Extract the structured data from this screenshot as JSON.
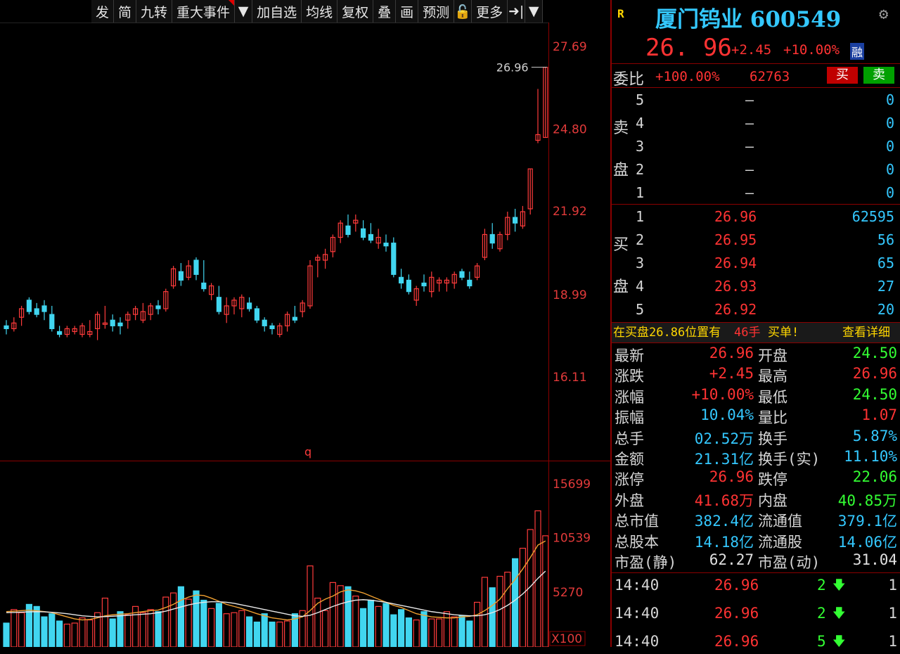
{
  "toolbar": {
    "items": [
      {
        "label": "发"
      },
      {
        "label": "简"
      },
      {
        "label": "九转"
      },
      {
        "label": "重大事件",
        "flag": true
      },
      {
        "label": "▼",
        "square": true
      },
      {
        "label": "加自选"
      },
      {
        "label": "均线"
      },
      {
        "label": "复权"
      },
      {
        "label": "叠"
      },
      {
        "label": "画"
      },
      {
        "label": "预测"
      },
      {
        "label": "🔓",
        "square": true
      },
      {
        "label": "更多"
      },
      {
        "label": "➜|",
        "square": true
      },
      {
        "label": "▼",
        "square": true
      }
    ]
  },
  "chart_data": {
    "type": "candlestick",
    "price_axis_ticks": [
      "27.69",
      "24.80",
      "21.92",
      "18.99",
      "16.11"
    ],
    "price_axis_values": [
      27.69,
      24.8,
      21.92,
      18.99,
      16.11
    ],
    "volume_axis_ticks": [
      "15699",
      "10539",
      "5270"
    ],
    "volume_unit": "X100",
    "last_price_label": "26.96",
    "marker_label": "q",
    "candles": [
      [
        17.9,
        18.1,
        17.6,
        17.8
      ],
      [
        17.8,
        18.2,
        17.7,
        18.0
      ],
      [
        18.2,
        18.6,
        17.9,
        18.5
      ],
      [
        18.8,
        18.9,
        18.3,
        18.4
      ],
      [
        18.5,
        18.7,
        18.2,
        18.3
      ],
      [
        18.6,
        18.8,
        18.1,
        18.4
      ],
      [
        18.3,
        18.6,
        17.7,
        17.8
      ],
      [
        17.7,
        17.9,
        17.5,
        17.6
      ],
      [
        17.6,
        17.9,
        17.5,
        17.8
      ],
      [
        17.7,
        17.9,
        17.6,
        17.8
      ],
      [
        17.6,
        18.0,
        17.5,
        17.9
      ],
      [
        17.6,
        18.1,
        17.5,
        17.7
      ],
      [
        17.8,
        18.4,
        17.4,
        18.3
      ],
      [
        18.0,
        18.6,
        17.8,
        18.0
      ],
      [
        18.1,
        18.3,
        17.7,
        17.9
      ],
      [
        18.0,
        18.2,
        17.6,
        17.9
      ],
      [
        18.1,
        18.4,
        17.8,
        18.3
      ],
      [
        18.3,
        18.6,
        18.1,
        18.5
      ],
      [
        18.1,
        18.7,
        18.0,
        18.4
      ],
      [
        18.3,
        18.7,
        18.1,
        18.6
      ],
      [
        18.6,
        18.8,
        18.3,
        18.5
      ],
      [
        18.5,
        19.2,
        18.4,
        19.1
      ],
      [
        19.3,
        20.0,
        19.2,
        19.9
      ],
      [
        19.8,
        20.1,
        19.3,
        19.5
      ],
      [
        19.6,
        20.2,
        19.5,
        20.0
      ],
      [
        20.2,
        20.3,
        19.5,
        19.7
      ],
      [
        19.4,
        20.2,
        19.1,
        19.2
      ],
      [
        19.0,
        19.4,
        18.8,
        19.3
      ],
      [
        18.9,
        19.3,
        18.3,
        18.4
      ],
      [
        18.3,
        18.9,
        18.0,
        18.6
      ],
      [
        18.6,
        18.9,
        18.3,
        18.8
      ],
      [
        18.5,
        19.0,
        18.2,
        18.9
      ],
      [
        18.7,
        18.9,
        18.4,
        18.5
      ],
      [
        18.5,
        18.6,
        18.0,
        18.1
      ],
      [
        18.1,
        18.2,
        17.7,
        17.9
      ],
      [
        17.9,
        18.0,
        17.6,
        17.8
      ],
      [
        17.6,
        18.0,
        17.5,
        17.9
      ],
      [
        17.9,
        18.4,
        17.7,
        18.3
      ],
      [
        18.2,
        18.6,
        18.0,
        18.1
      ],
      [
        18.4,
        18.8,
        18.2,
        18.7
      ],
      [
        18.6,
        20.2,
        18.5,
        20.0
      ],
      [
        20.2,
        20.4,
        19.6,
        20.3
      ],
      [
        20.2,
        20.6,
        19.9,
        20.4
      ],
      [
        20.5,
        21.1,
        20.3,
        21.0
      ],
      [
        21.0,
        21.6,
        20.8,
        21.5
      ],
      [
        21.4,
        21.8,
        21.0,
        21.1
      ],
      [
        21.5,
        21.8,
        21.2,
        21.6
      ],
      [
        21.3,
        21.6,
        20.9,
        21.0
      ],
      [
        21.1,
        21.5,
        20.8,
        20.9
      ],
      [
        20.8,
        21.3,
        20.6,
        21.0
      ],
      [
        20.8,
        21.1,
        20.5,
        20.7
      ],
      [
        20.8,
        21.0,
        19.6,
        19.7
      ],
      [
        19.6,
        19.9,
        19.2,
        19.4
      ],
      [
        19.5,
        19.7,
        19.0,
        19.1
      ],
      [
        18.8,
        19.3,
        18.6,
        19.2
      ],
      [
        19.4,
        19.7,
        19.1,
        19.3
      ],
      [
        19.1,
        19.8,
        18.9,
        19.6
      ],
      [
        19.4,
        19.6,
        19.1,
        19.5
      ],
      [
        19.4,
        19.6,
        19.1,
        19.5
      ],
      [
        19.4,
        19.8,
        19.2,
        19.7
      ],
      [
        19.8,
        19.9,
        19.5,
        19.6
      ],
      [
        19.5,
        19.8,
        19.2,
        19.3
      ],
      [
        19.6,
        20.1,
        19.5,
        20.0
      ],
      [
        20.3,
        21.3,
        20.2,
        21.1
      ],
      [
        21.1,
        21.5,
        20.6,
        20.8
      ],
      [
        20.6,
        21.2,
        20.5,
        21.1
      ],
      [
        21.1,
        21.9,
        20.9,
        21.7
      ],
      [
        21.7,
        22.0,
        21.2,
        21.5
      ],
      [
        21.4,
        22.1,
        21.3,
        21.9
      ],
      [
        22.0,
        23.4,
        21.8,
        23.4
      ],
      [
        24.4,
        26.2,
        24.3,
        24.6
      ],
      [
        24.5,
        26.96,
        24.5,
        26.96
      ]
    ],
    "volumes": [
      2300,
      3600,
      3300,
      4100,
      3900,
      2900,
      3200,
      2500,
      2200,
      2300,
      2800,
      2600,
      3300,
      4700,
      2700,
      3400,
      3100,
      3900,
      3300,
      3600,
      3400,
      4800,
      5200,
      5800,
      4600,
      5400,
      4500,
      3700,
      4200,
      3200,
      3300,
      3500,
      2900,
      2400,
      3200,
      2400,
      2400,
      2500,
      3200,
      3500,
      7800,
      4700,
      3500,
      6200,
      5900,
      5800,
      4900,
      3700,
      4500,
      3900,
      4200,
      3100,
      3600,
      2800,
      2600,
      3400,
      2700,
      2700,
      3400,
      2900,
      3000,
      2500,
      4300,
      6700,
      5700,
      6800,
      7200,
      8500,
      9500,
      11300,
      13100,
      10700
    ],
    "ma5": [
      3400,
      3450,
      3500,
      3550,
      3480,
      3400,
      3300,
      3100,
      2900,
      2700,
      2600,
      2650,
      2800,
      3000,
      3100,
      3150,
      3200,
      3300,
      3400,
      3500,
      3550,
      3800,
      4100,
      4500,
      4800,
      5000,
      4950,
      4700,
      4400,
      4100,
      3900,
      3700,
      3450,
      3200,
      3000,
      2800,
      2700,
      2600,
      2700,
      2900,
      3500,
      4200,
      4600,
      4900,
      5300,
      5500,
      5400,
      5200,
      4900,
      4600,
      4300,
      4000,
      3800,
      3500,
      3200,
      3050,
      2900,
      2850,
      2800,
      2800,
      2900,
      2950,
      3100,
      3500,
      4000,
      4600,
      5600,
      6500,
      7500,
      8600,
      9800,
      10200
    ],
    "ma10": [
      3300,
      3320,
      3350,
      3380,
      3400,
      3380,
      3340,
      3280,
      3200,
      3100,
      3000,
      2950,
      2900,
      2920,
      2960,
      3000,
      3050,
      3100,
      3150,
      3200,
      3300,
      3450,
      3650,
      3850,
      4050,
      4200,
      4300,
      4350,
      4350,
      4300,
      4200,
      4050,
      3900,
      3750,
      3600,
      3450,
      3300,
      3150,
      3000,
      2950,
      3050,
      3300,
      3600,
      3900,
      4150,
      4350,
      4500,
      4550,
      4500,
      4400,
      4300,
      4150,
      4000,
      3850,
      3700,
      3550,
      3400,
      3300,
      3200,
      3100,
      3050,
      3000,
      3000,
      3100,
      3300,
      3600,
      4000,
      4500,
      5100,
      5800,
      6600,
      7300
    ]
  },
  "panel": {
    "r_badge": "R",
    "title": "厦门钨业 600549",
    "price": "26. 96",
    "change": "+2.45",
    "pct": "+10.00%",
    "fin_badge": "融",
    "weibi_label": "委比",
    "weibi_pct": "+100.00%",
    "weibi_num": "62763",
    "buy_btn": "买",
    "sell_btn": "卖",
    "sell_label_1": "卖",
    "sell_label_2": "盘",
    "buy_label_1": "买",
    "buy_label_2": "盘",
    "sell_levels": [
      {
        "n": "5",
        "price": "—",
        "vol": "0"
      },
      {
        "n": "4",
        "price": "—",
        "vol": "0"
      },
      {
        "n": "3",
        "price": "—",
        "vol": "0"
      },
      {
        "n": "2",
        "price": "—",
        "vol": "0"
      },
      {
        "n": "1",
        "price": "—",
        "vol": "0"
      }
    ],
    "buy_levels": [
      {
        "n": "1",
        "price": "26.96",
        "vol": "62595"
      },
      {
        "n": "2",
        "price": "26.95",
        "vol": "56"
      },
      {
        "n": "3",
        "price": "26.94",
        "vol": "65"
      },
      {
        "n": "4",
        "price": "26.93",
        "vol": "27"
      },
      {
        "n": "5",
        "price": "26.92",
        "vol": "20"
      }
    ],
    "notice_a": "在买盘26.86位置有",
    "notice_b": "46手",
    "notice_c": "买单!",
    "notice_link": "查看详细",
    "quotes": [
      {
        "l1": "最新",
        "v1": "26.96",
        "c1": "red",
        "l2": "开盘",
        "v2": "24.50",
        "c2": "green"
      },
      {
        "l1": "涨跌",
        "v1": "+2.45",
        "c1": "red",
        "l2": "最高",
        "v2": "26.96",
        "c2": "red"
      },
      {
        "l1": "涨幅",
        "v1": "+10.00%",
        "c1": "red",
        "l2": "最低",
        "v2": "24.50",
        "c2": "green"
      },
      {
        "l1": "振幅",
        "v1": "10.04%",
        "c1": "cyan",
        "l2": "量比",
        "v2": "1.07",
        "c2": "red"
      },
      {
        "l1": "总手",
        "v1": "02.52万",
        "c1": "cyan",
        "l2": "换手",
        "v2": "5.87%",
        "c2": "cyan"
      },
      {
        "l1": "金额",
        "v1": "21.31亿",
        "c1": "cyan",
        "l2": "换手(实)",
        "v2": "11.10%",
        "c2": "cyan"
      },
      {
        "l1": "涨停",
        "v1": "26.96",
        "c1": "red",
        "l2": "跌停",
        "v2": "22.06",
        "c2": "green"
      },
      {
        "l1": "外盘",
        "v1": "41.68万",
        "c1": "red",
        "l2": "内盘",
        "v2": "40.85万",
        "c2": "green"
      },
      {
        "l1": "总市值",
        "v1": "382.4亿",
        "c1": "cyan",
        "l2": "流通值",
        "v2": "379.1亿",
        "c2": "cyan"
      },
      {
        "l1": "总股本",
        "v1": "14.18亿",
        "c1": "cyan",
        "l2": "流通股",
        "v2": "14.06亿",
        "c2": "cyan"
      },
      {
        "l1": "市盈(静)",
        "v1": "62.27",
        "c1": "white",
        "l2": "市盈(动)",
        "v2": "31.04",
        "c2": "white"
      }
    ],
    "ticks": [
      {
        "time": "14:40",
        "price": "26.96",
        "qty": "2",
        "dir": "🡇",
        "n": "1"
      },
      {
        "time": "14:40",
        "price": "26.96",
        "qty": "2",
        "dir": "🡇",
        "n": "1"
      },
      {
        "time": "14:40",
        "price": "26.96",
        "qty": "5",
        "dir": "🡇",
        "n": "1"
      }
    ]
  },
  "colors": {
    "up": "#ff3b3b",
    "down": "#41d6f0",
    "ma5": "#f0a030",
    "ma10": "#e8e8e8",
    "grid": "#8a0000"
  }
}
